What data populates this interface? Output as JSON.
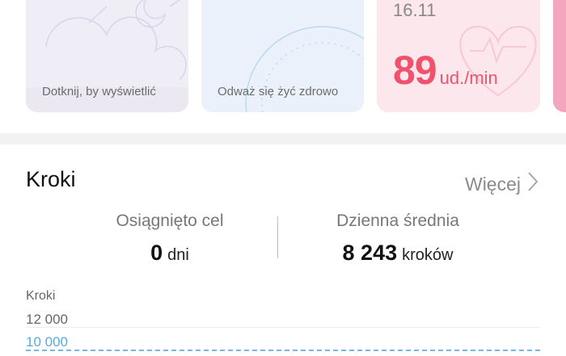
{
  "cards": {
    "sleep": {
      "caption": "Dotknij, by wyświetlić"
    },
    "stress": {
      "caption": "Odważ się żyć zdrowo"
    },
    "heart_rate": {
      "date": "16.11",
      "value": "89",
      "unit": "ud./min"
    }
  },
  "steps": {
    "title": "Kroki",
    "more_label": "Więcej",
    "goal": {
      "label": "Osiągnięto cel",
      "value": "0",
      "unit": "dni"
    },
    "daily_avg": {
      "label": "Dzienna średnia",
      "value": "8 243",
      "unit": "kroków"
    },
    "chart": {
      "axis_title": "Kroki",
      "ticks": [
        "12 000",
        "10 000"
      ]
    }
  },
  "colors": {
    "heart_accent": "#f0526e",
    "goal_line": "#79b6e0",
    "separator": "#f2f2f2"
  },
  "chart_data": {
    "type": "bar",
    "ylabel": "Kroki",
    "yticks": [
      12000,
      10000
    ],
    "goal_line": 10000,
    "grid": true
  }
}
